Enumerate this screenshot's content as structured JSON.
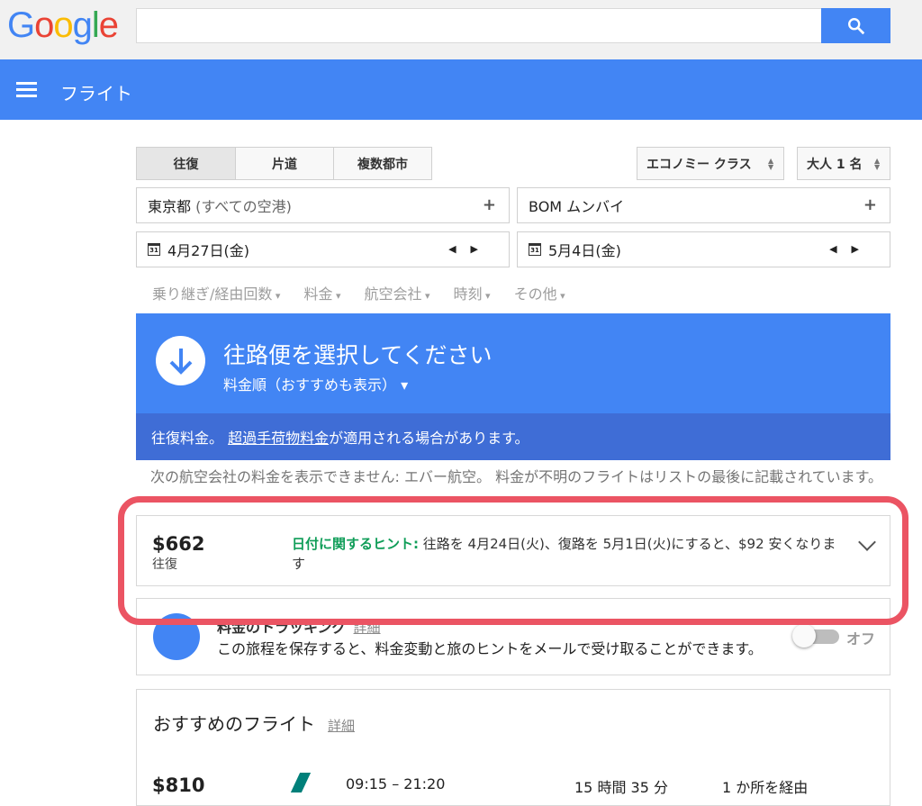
{
  "logo": [
    "G",
    "o",
    "o",
    "g",
    "l",
    "e"
  ],
  "search": {
    "placeholder": ""
  },
  "appbar": {
    "title": "フライト"
  },
  "trip_types": [
    "往復",
    "片道",
    "複数都市"
  ],
  "cabin": "エコノミー クラス",
  "passengers": "大人 1 名",
  "origin": {
    "main": "東京都",
    "sub": "(すべての空港)"
  },
  "destination": "BOM ムンバイ",
  "depart_date": "4月27日(金)",
  "return_date": "5月4日(金)",
  "calendar_day": "31",
  "filters": [
    "乗り継ぎ/経由回数",
    "料金",
    "航空会社",
    "時刻",
    "その他"
  ],
  "banner": {
    "title": "往路便を選択してください",
    "sort": "料金順（おすすめも表示）"
  },
  "subbanner": {
    "prefix": "往復料金。",
    "link": "超過手荷物料金",
    "suffix": "が適用される場合があります。"
  },
  "notice": "次の航空会社の料金を表示できません: エバー航空。 料金が不明のフライトはリストの最後に記載されています。",
  "hint_card": {
    "price": "$662",
    "price_sub": "往復",
    "hint_label": "日付に関するヒント:",
    "hint_text": " 往路を 4月24日(火)、復路を 5月1日(火)にすると、$92 安くなります"
  },
  "tracking": {
    "title": "料金のトラッキング",
    "link": "詳細",
    "text": "この旅程を保存すると、料金変動と旅のヒントをメールで受け取ることができます。",
    "toggle_label": "オフ"
  },
  "recommended": {
    "title": "おすすめのフライト",
    "link": "詳細",
    "price": "$810",
    "time": "09:15 – 21:20",
    "duration": "15 時間 35 分",
    "stops": "1 か所を経由"
  },
  "colors": {
    "primary": "#4285f4",
    "highlight": "#eb5463",
    "hint_green": "#0f9d58"
  }
}
